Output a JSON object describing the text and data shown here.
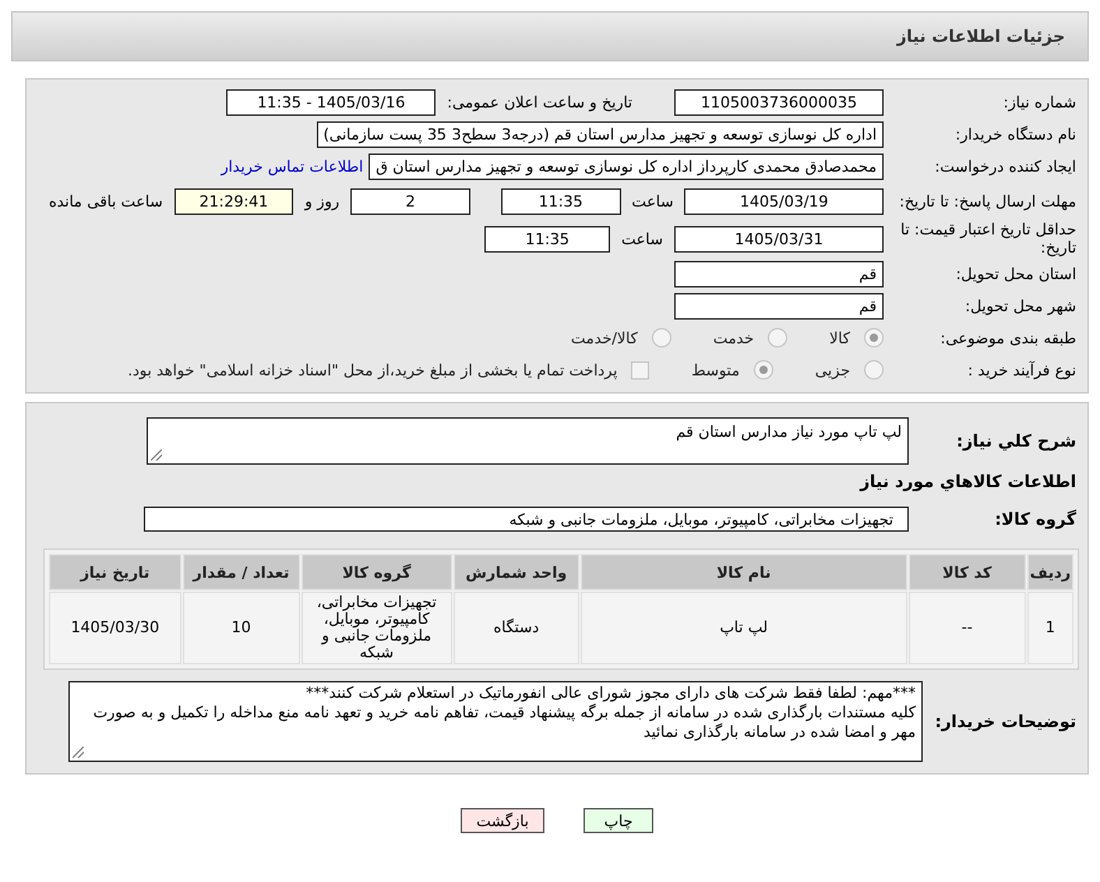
{
  "header": {
    "title": "جزئیات اطلاعات نیاز"
  },
  "need_number": {
    "label": "شماره نیاز:",
    "value": "1105003736000035"
  },
  "announce": {
    "label": "تاریخ و ساعت اعلان عمومی:",
    "value": "1405/03/16 - 11:35"
  },
  "buyer": {
    "label": "نام دستگاه خریدار:",
    "value": "اداره کل نوسازی   توسعه و تجهیز مدارس استان قم (درجه3 سطح3  35 پست سازمانی)"
  },
  "requester": {
    "label": "ایجاد کننده درخواست:",
    "value": "محمدصادق محمدی کارپرداز  اداره کل نوسازی   توسعه و تجهیز مدارس استان ق",
    "link": "اطلاعات تماس خریدار"
  },
  "deadline": {
    "label": "مهلت ارسال پاسخ: تا تاریخ:",
    "date": "1405/03/19",
    "time_label": "ساعت",
    "time": "11:35",
    "days": "2",
    "days_label": "روز و",
    "remaining": "21:29:41",
    "remaining_label": "ساعت باقی مانده"
  },
  "validity": {
    "label": "حداقل تاریخ اعتبار قیمت: تا تاریخ:",
    "date": "1405/03/31",
    "time_label": "ساعت",
    "time": "11:35"
  },
  "province": {
    "label": "استان محل تحویل:",
    "value": "قم"
  },
  "city": {
    "label": "شهر محل تحویل:",
    "value": "قم"
  },
  "category": {
    "label": "طبقه بندی موضوعی:",
    "options": [
      {
        "label": "کالا",
        "selected": true
      },
      {
        "label": "خدمت",
        "selected": false
      },
      {
        "label": "کالا/خدمت",
        "selected": false
      }
    ]
  },
  "process": {
    "label": "نوع فرآیند خرید :",
    "options": [
      {
        "label": "جزیی",
        "selected": false
      },
      {
        "label": "متوسط",
        "selected": true
      }
    ],
    "payment": {
      "label": "پرداخت تمام یا بخشی از مبلغ خرید،از محل \"اسناد خزانه اسلامی\" خواهد بود.",
      "checked": false
    }
  },
  "description": {
    "label": "شرح کلي نياز:",
    "value": "لپ تاپ مورد نیاز مدارس استان قم"
  },
  "goods_section": {
    "title": "اطلاعات کالاهاي مورد نياز"
  },
  "goods_group": {
    "label": "گروه کالا:",
    "value": "تجهیزات مخابراتی، کامپیوتر، موبایل، ملزومات جانبی و شبکه"
  },
  "table": {
    "columns": [
      "ردیف",
      "کد کالا",
      "نام کالا",
      "واحد شمارش",
      "گروه کالا",
      "تعداد / مقدار",
      "تاریخ نیاز"
    ],
    "rows": [
      [
        "1",
        "--",
        "لپ تاپ",
        "دستگاه",
        "تجهیزات مخابراتی، کامپیوتر، موبایل، ملزومات جانبی و شبکه",
        "10",
        "1405/03/30"
      ]
    ]
  },
  "notes": {
    "label": "توضیحات خریدار:",
    "lines": [
      "***مهم: لطفا فقط شرکت های دارای مجوز شورای عالی انفورماتیک در استعلام شرکت کنند***",
      "کلیه مستندات بارگذاری شده در سامانه از جمله برگه پیشنهاد قیمت، تفاهم نامه خرید و تعهد نامه منع مداخله را تکمیل و به صورت مهر و امضا شده در سامانه بارگذاری نمائید"
    ]
  },
  "buttons": [
    {
      "label": "چاپ",
      "kind": "print"
    },
    {
      "label": "بازگشت",
      "kind": "back"
    }
  ]
}
